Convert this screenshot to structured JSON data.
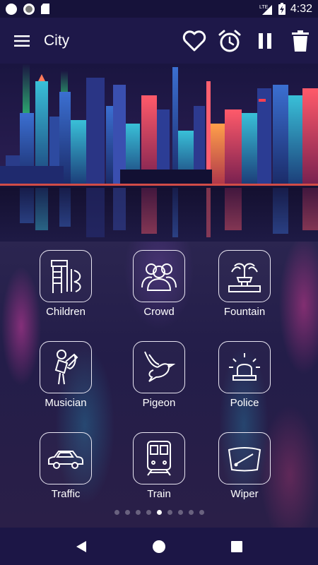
{
  "status_bar": {
    "network": "LTE",
    "time": "4:32",
    "icons": [
      "notification-dot-icon",
      "notification-ring-icon",
      "sd-card-icon",
      "signal-icon",
      "battery-charging-icon"
    ]
  },
  "app_bar": {
    "title": "City",
    "menu_icon": "hamburger-menu-icon",
    "actions": [
      "heart-icon",
      "alarm-clock-icon",
      "pause-icon",
      "trash-icon"
    ]
  },
  "sounds": [
    {
      "label": "Children",
      "icon": "playground-slide-icon"
    },
    {
      "label": "Crowd",
      "icon": "crowd-icon"
    },
    {
      "label": "Fountain",
      "icon": "fountain-icon"
    },
    {
      "label": "Musician",
      "icon": "saxophone-player-icon"
    },
    {
      "label": "Pigeon",
      "icon": "pigeon-icon"
    },
    {
      "label": "Police",
      "icon": "siren-light-icon"
    },
    {
      "label": "Traffic",
      "icon": "car-icon"
    },
    {
      "label": "Train",
      "icon": "train-icon"
    },
    {
      "label": "Wiper",
      "icon": "windshield-wiper-icon"
    }
  ],
  "pagination": {
    "total": 9,
    "active_index": 4
  },
  "nav_bar": [
    "back-icon",
    "home-icon",
    "recents-icon"
  ],
  "colors": {
    "app_bar": "#1e1849",
    "status_bar": "#16123a",
    "nav_bar": "#1c1646",
    "tile_border": "#e9e6f2"
  }
}
